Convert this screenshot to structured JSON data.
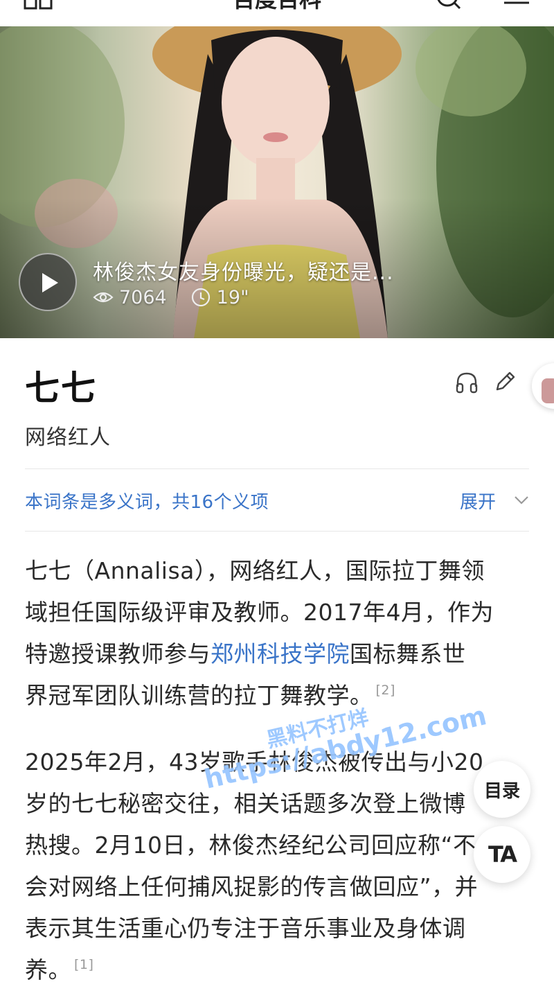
{
  "topbar": {
    "title": "百度百科",
    "menu_icon": "app-grid-icon",
    "search_icon": "search-icon",
    "list_icon": "menu-list-icon"
  },
  "video": {
    "title": "林俊杰女友身份曝光，疑还是...",
    "views": "7064",
    "duration": "19\"",
    "play_icon": "play-icon",
    "views_icon": "eye-icon",
    "duration_icon": "clock-icon"
  },
  "entry": {
    "title": "七七",
    "subtitle": "网络红人",
    "listen_icon": "headphone-icon",
    "edit_icon": "edit-icon"
  },
  "polysemy": {
    "text": "本词条是多义词，共16个义项",
    "expand_label": "展开"
  },
  "paragraph1": {
    "line1": "七七（Annalisa），网络红人，国际拉丁舞领",
    "line2": "域担任国际级评审及教师。2017年4月，作为",
    "line3_pre": "特邀授课教师参与",
    "line3_link": "郑州科技学院",
    "line3_post": "国标舞系世",
    "line4": "界冠军团队训练营的拉丁舞教学。",
    "ref": "[2]"
  },
  "paragraph2": {
    "line1": "2025年2月，43岁歌手林俊杰被传出与小20",
    "line2": "岁的七七秘密交往，相关话题多次登上微博",
    "line3": "热搜。2月10日，林俊杰经纪公司回应称“不",
    "line4": "会对网络上任何捕风捉影的传言做回应”，并",
    "line5": "表示其生活重心仍专注于音乐事业及身体调",
    "line6": "养。",
    "ref": "[1]"
  },
  "float": {
    "toc_label": "目录",
    "ta_label": "TA"
  },
  "watermark": {
    "line1": "黑料不打烊",
    "line2": "https://abdy12.com"
  },
  "colors": {
    "link": "#3a74c8",
    "text": "#2a2a2a",
    "watermark": "#78b4ff"
  }
}
